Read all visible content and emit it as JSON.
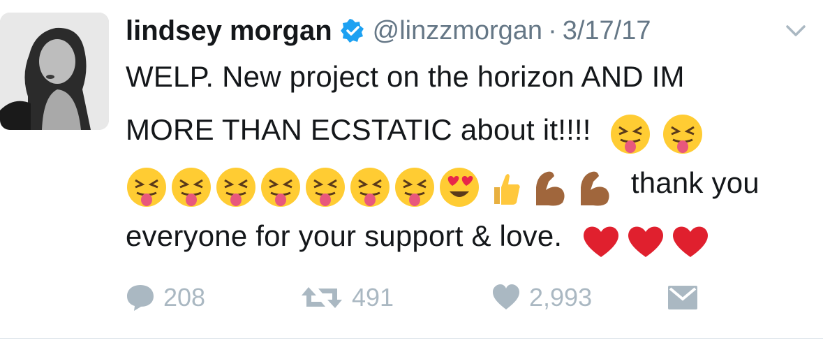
{
  "tweet": {
    "author_name": "lindsey morgan",
    "handle": "@linzzmorgan",
    "separator": "·",
    "date": "3/17/17",
    "text_line1": "WELP. New project on the horizon AND IM",
    "text_line2": "MORE THAN ECSTATIC about it!!!!",
    "text_line3": "thank you",
    "text_line4": "everyone for your support & love.",
    "emojis_line2": [
      "squinting-tongue-emoji",
      "squinting-tongue-emoji"
    ],
    "emojis_line3": [
      "squinting-tongue-emoji",
      "squinting-tongue-emoji",
      "squinting-tongue-emoji",
      "squinting-tongue-emoji",
      "squinting-tongue-emoji",
      "squinting-tongue-emoji",
      "squinting-tongue-emoji",
      "heart-eyes-emoji",
      "thumbs-up-emoji",
      "flexed-biceps-emoji",
      "flexed-biceps-emoji"
    ],
    "emojis_line4": [
      "red-heart-emoji",
      "red-heart-emoji",
      "red-heart-emoji"
    ]
  },
  "actions": {
    "reply_count": "208",
    "retweet_count": "491",
    "like_count": "2,993"
  },
  "icons": {
    "verified": "verified-badge-icon",
    "chevron": "chevron-down-icon",
    "reply": "reply-bubble-icon",
    "retweet": "retweet-icon",
    "like": "heart-icon",
    "message": "envelope-icon"
  },
  "colors": {
    "text": "#14171a",
    "secondary": "#657786",
    "action_gray": "#aab8c2",
    "verified_blue": "#1da1f2"
  }
}
